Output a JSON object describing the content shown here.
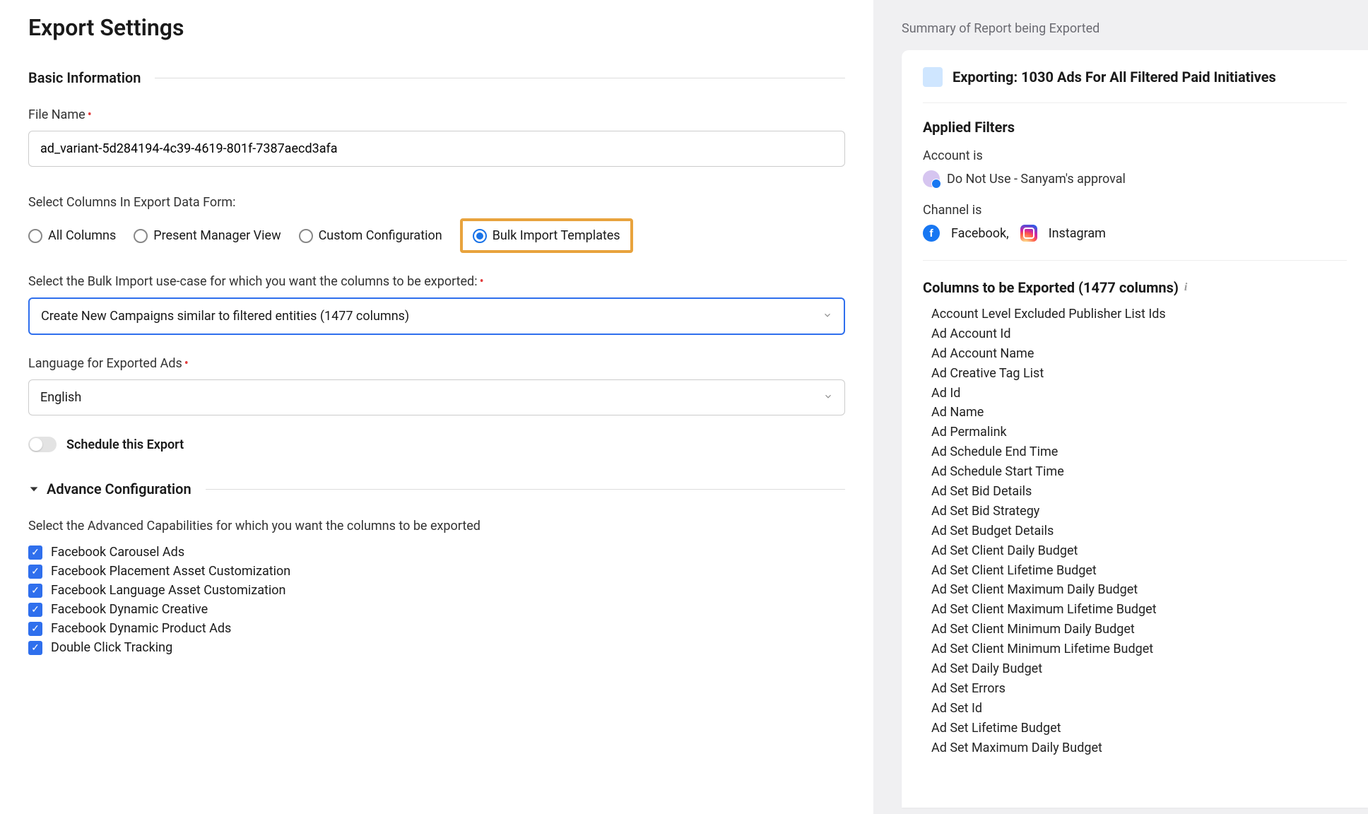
{
  "page_title": "Export Settings",
  "sections": {
    "basic_info": "Basic Information",
    "advance_config": "Advance Configuration"
  },
  "file_name": {
    "label": "File Name",
    "value": "ad_variant-5d284194-4c39-4619-801f-7387aecd3afa"
  },
  "columns_form": {
    "label": "Select Columns In Export Data Form:",
    "options": {
      "all": "All Columns",
      "present": "Present Manager View",
      "custom": "Custom Configuration",
      "bulk": "Bulk Import Templates"
    },
    "selected": "bulk"
  },
  "bulk_usecase": {
    "label": "Select the Bulk Import use-case for which you want the columns to be exported:",
    "value": "Create New Campaigns similar to filtered entities (1477 columns)"
  },
  "language": {
    "label": "Language for Exported Ads",
    "value": "English"
  },
  "schedule_label": "Schedule this Export",
  "adv_capabilities": {
    "label": "Select the Advanced Capabilities for which you want the columns to be exported",
    "items": [
      "Facebook Carousel Ads",
      "Facebook Placement Asset Customization",
      "Facebook Language Asset Customization",
      "Facebook Dynamic Creative",
      "Facebook Dynamic Product Ads",
      "Double Click Tracking"
    ]
  },
  "summary": {
    "panel_title": "Summary of Report being Exported",
    "export_heading": "Exporting: 1030 Ads For All Filtered Paid Initiatives",
    "applied_filters_title": "Applied Filters",
    "account_label": "Account is",
    "account_value": "Do Not Use - Sanyam's approval",
    "channel_label": "Channel is",
    "channel_fb": "Facebook,",
    "channel_ig": "Instagram",
    "columns_title": "Columns to be Exported (1477 columns)",
    "columns": [
      "Account Level Excluded Publisher List Ids",
      "Ad Account Id",
      "Ad Account Name",
      "Ad Creative Tag List",
      "Ad Id",
      "Ad Name",
      "Ad Permalink",
      "Ad Schedule End Time",
      "Ad Schedule Start Time",
      "Ad Set Bid Details",
      "Ad Set Bid Strategy",
      "Ad Set Budget Details",
      "Ad Set Client Daily Budget",
      "Ad Set Client Lifetime Budget",
      "Ad Set Client Maximum Daily Budget",
      "Ad Set Client Maximum Lifetime Budget",
      "Ad Set Client Minimum Daily Budget",
      "Ad Set Client Minimum Lifetime Budget",
      "Ad Set Daily Budget",
      "Ad Set Errors",
      "Ad Set Id",
      "Ad Set Lifetime Budget",
      "Ad Set Maximum Daily Budget"
    ]
  }
}
